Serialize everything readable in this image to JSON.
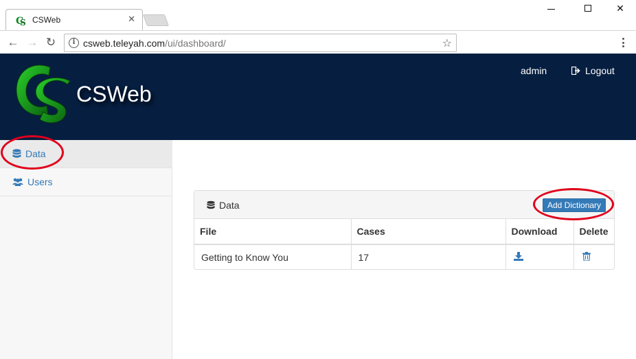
{
  "browser": {
    "tab_title": "CSWeb",
    "tab_close": "✕",
    "url_host": "csweb.teleyah.com",
    "url_path": "/ui/dashboard/",
    "info_glyph": "i",
    "star_glyph": "☆",
    "back_glyph": "←",
    "forward_glyph": "→",
    "reload_glyph": "↻",
    "close_glyph": "✕"
  },
  "header": {
    "brand": "CSWeb",
    "user": "admin",
    "logout": "Logout",
    "background_color": "#061e40"
  },
  "sidebar": {
    "items": [
      {
        "label": "Data",
        "icon": "database-icon",
        "active": true
      },
      {
        "label": "Users",
        "icon": "users-icon",
        "active": false
      }
    ],
    "link_color": "#337ab7"
  },
  "panel": {
    "title": "Data",
    "add_button": "Add Dictionary",
    "columns": [
      "File",
      "Cases",
      "Download",
      "Delete"
    ],
    "rows": [
      {
        "file": "Getting to Know You",
        "cases": "17"
      }
    ]
  },
  "annotation_color": "#e0001b"
}
